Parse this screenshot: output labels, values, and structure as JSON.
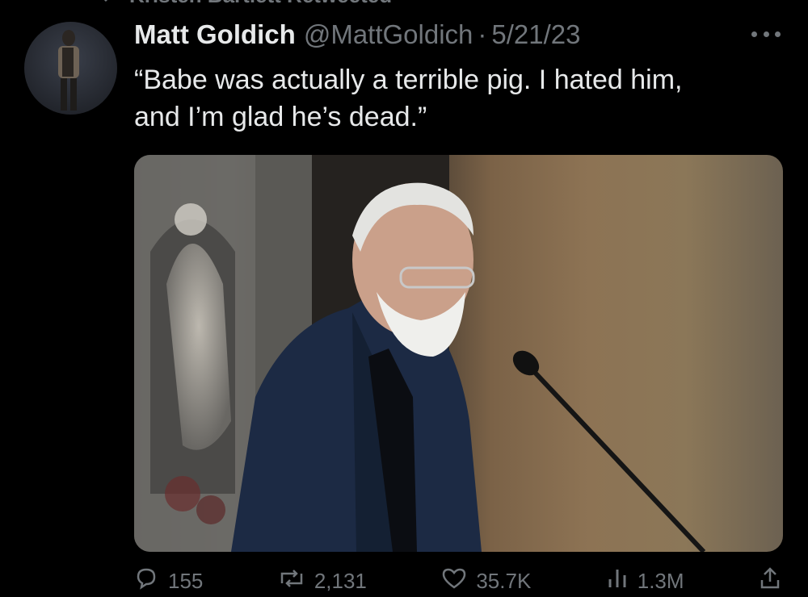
{
  "retweet": {
    "text": "Kristen Bartlett Retweeted"
  },
  "tweet": {
    "name": "Matt Goldich",
    "handle": "@MattGoldich",
    "separator": "·",
    "date": "5/21/23",
    "text_line1": "“Babe was actually a terrible pig. I hated him,",
    "text_line2": "and I’m glad he’s dead.”"
  },
  "actions": {
    "reply_count": "155",
    "retweet_count": "2,131",
    "like_count": "35.7K",
    "views_count": "1.3M"
  },
  "colors": {
    "background": "#000000",
    "text": "#e7e9ea",
    "muted": "#71767b"
  }
}
